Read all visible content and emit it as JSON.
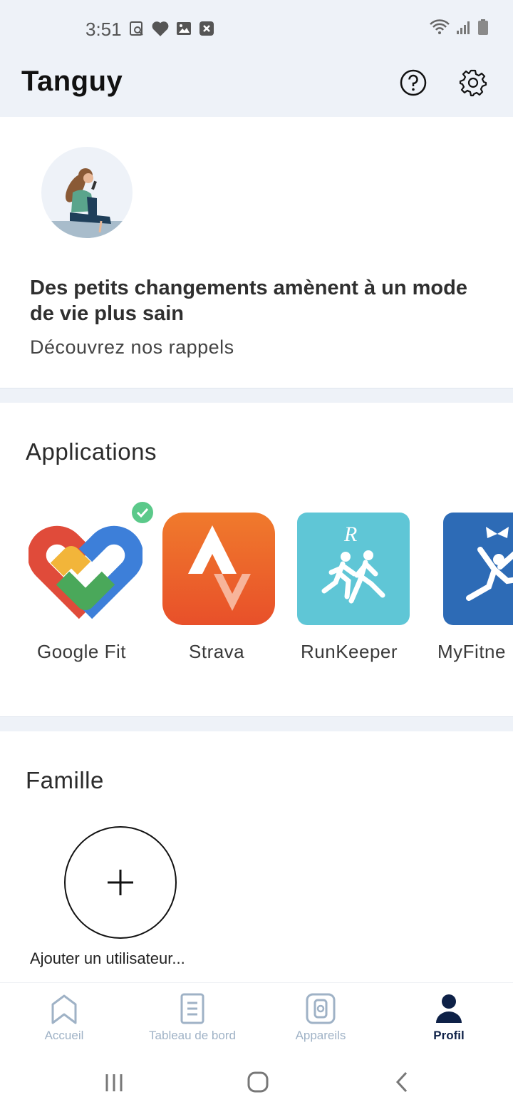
{
  "status": {
    "time": "3:51"
  },
  "header": {
    "title": "Tanguy"
  },
  "hero": {
    "title": "Des petits changements amènent à un mode de vie plus sain",
    "subtitle": "Découvrez nos rappels"
  },
  "applications": {
    "title": "Applications",
    "items": [
      {
        "label": "Google Fit",
        "connected": true
      },
      {
        "label": "Strava",
        "connected": false
      },
      {
        "label": "RunKeeper",
        "connected": false
      },
      {
        "label": "MyFitne",
        "connected": false
      }
    ]
  },
  "family": {
    "title": "Famille",
    "add_label": "Ajouter un utilisateur..."
  },
  "bottom_nav": {
    "items": [
      {
        "label": "Accueil",
        "active": false
      },
      {
        "label": "Tableau de bord",
        "active": false
      },
      {
        "label": "Appareils",
        "active": false
      },
      {
        "label": "Profil",
        "active": true
      }
    ]
  },
  "colors": {
    "header_bg": "#eef2f8",
    "active_nav": "#0e2147",
    "inactive_nav": "#9fb2c6",
    "check_green": "#5bc98a",
    "strava_orange": "#ef5a2a",
    "runkeeper_teal": "#5fc6d6",
    "myfitness_blue": "#2d6bb6"
  }
}
